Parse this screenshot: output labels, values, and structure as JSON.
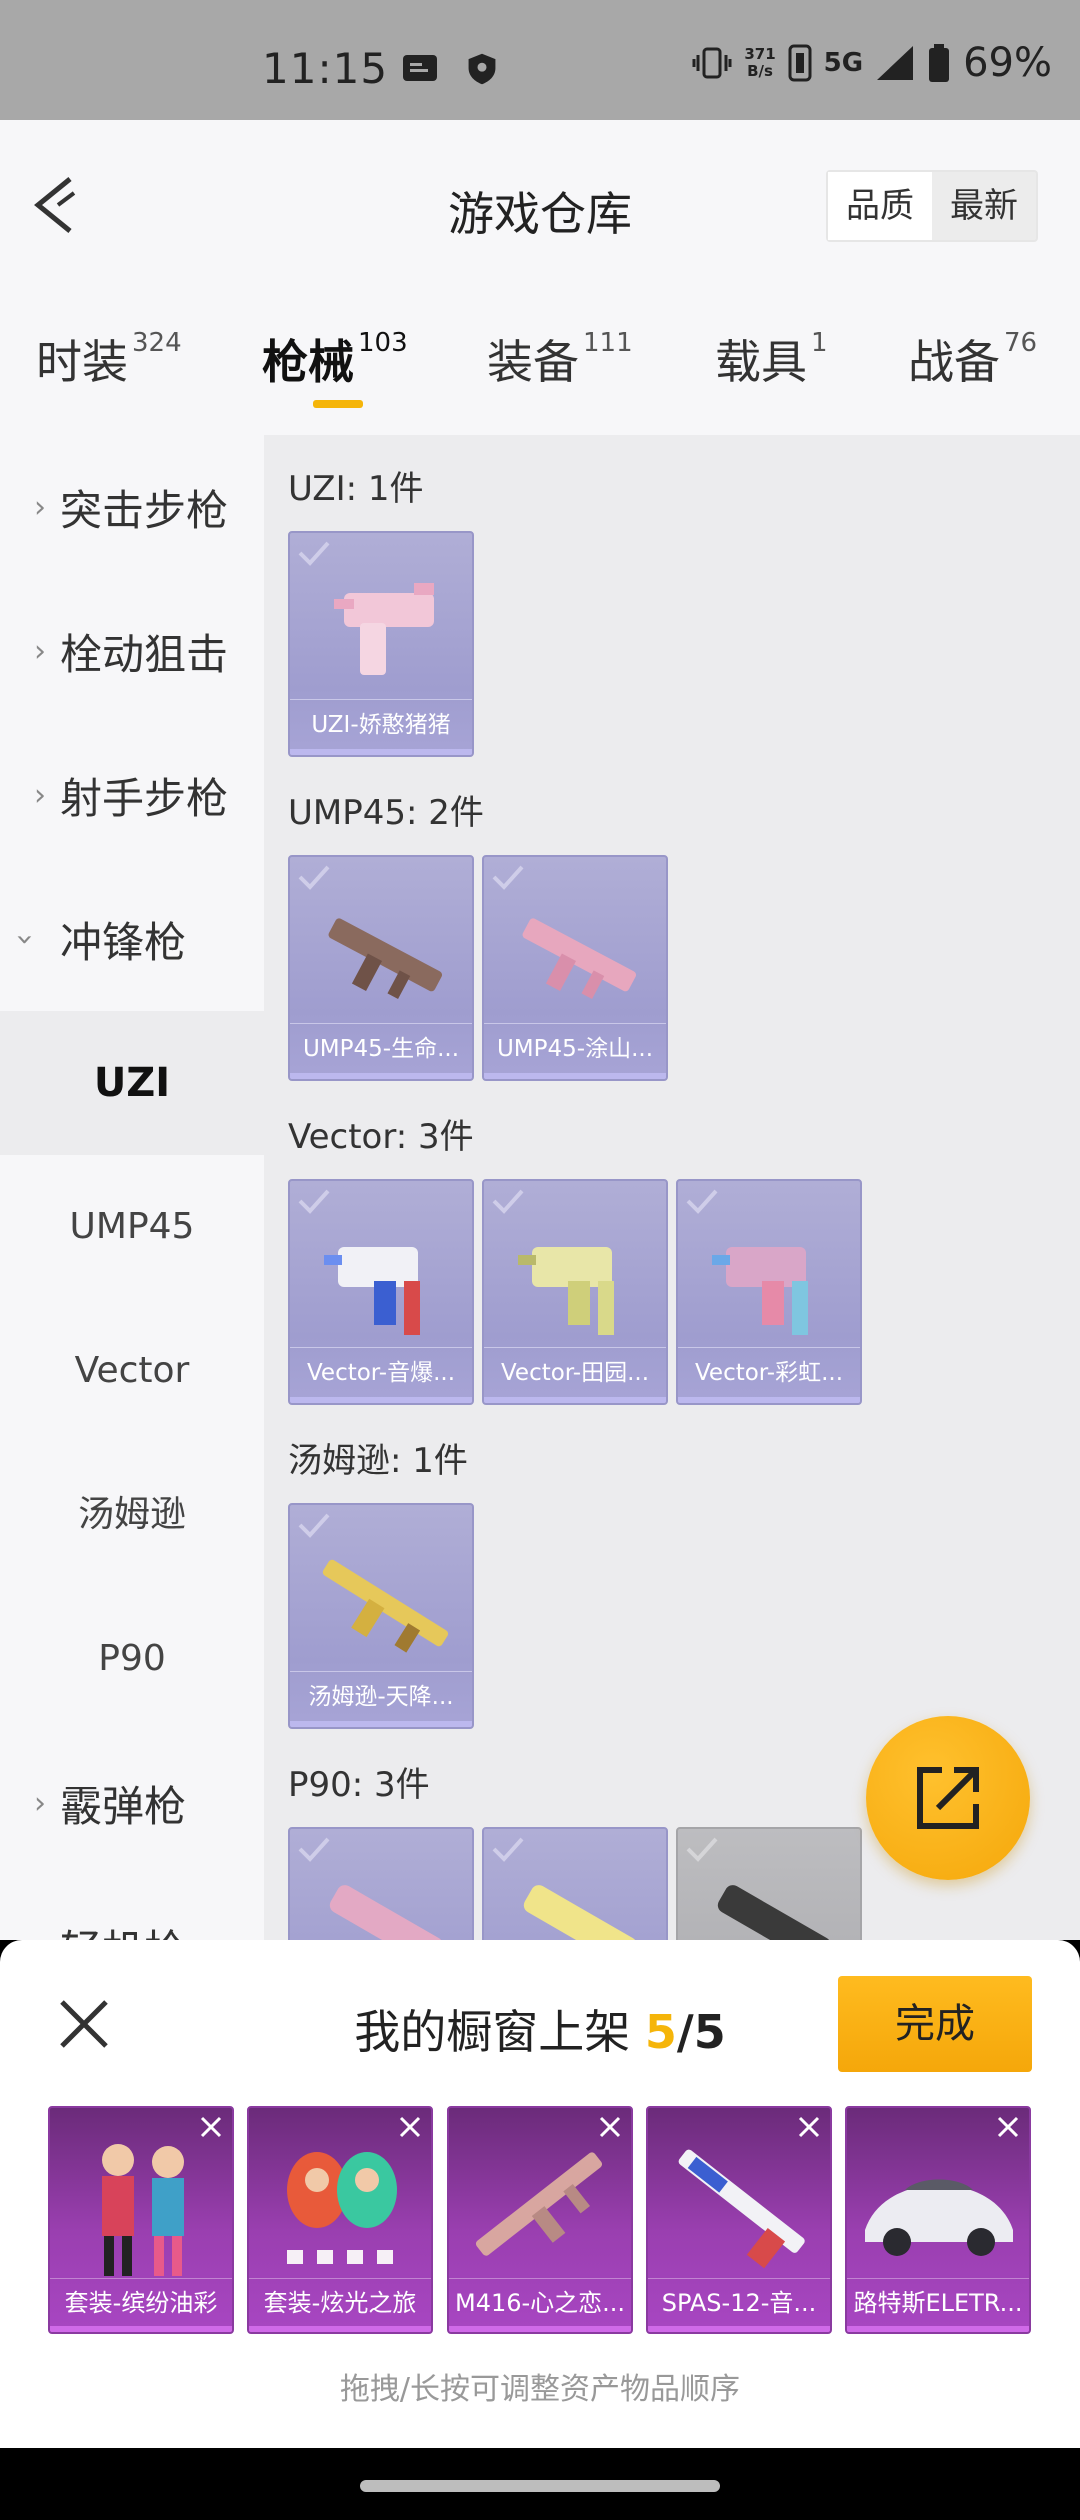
{
  "status": {
    "time": "11:15",
    "net_speed_top": "371",
    "net_speed_bottom": "B/s",
    "network": "5G",
    "battery": "69%"
  },
  "header": {
    "title": "游戏仓库",
    "sort_quality": "品质",
    "sort_newest": "最新"
  },
  "tabs": [
    {
      "label": "时装",
      "count": "324"
    },
    {
      "label": "枪械",
      "count": "103"
    },
    {
      "label": "装备",
      "count": "111"
    },
    {
      "label": "载具",
      "count": "1"
    },
    {
      "label": "战备",
      "count": "76"
    }
  ],
  "sidebar": {
    "categories": [
      "突击步枪",
      "栓动狙击",
      "射手步枪",
      "冲锋枪",
      "霰弹枪",
      "轻机枪"
    ],
    "subcategories": [
      "UZI",
      "UMP45",
      "Vector",
      "汤姆逊",
      "P90"
    ]
  },
  "groups": [
    {
      "title": "UZI: 1件",
      "items": [
        "UZI-娇憨猪猪"
      ]
    },
    {
      "title": "UMP45: 2件",
      "items": [
        "UMP45-生命...",
        "UMP45-涂山..."
      ]
    },
    {
      "title": "Vector: 3件",
      "items": [
        "Vector-音爆...",
        "Vector-田园...",
        "Vector-彩虹..."
      ]
    },
    {
      "title": "汤姆逊: 1件",
      "items": [
        "汤姆逊-天降..."
      ]
    },
    {
      "title": "P90: 3件",
      "items": [
        "",
        "",
        ""
      ]
    }
  ],
  "sheet": {
    "title": "我的橱窗上架",
    "count": "5",
    "slash": "/",
    "total": "5",
    "done_label": "完成",
    "items": [
      "套装-缤纷油彩",
      "套装-炫光之旅",
      "M416-心之恋...",
      "SPAS-12-音...",
      "路特斯ELETR..."
    ],
    "hint": "拖拽/长按可调整资产物品顺序"
  },
  "colors": {
    "accent": "#f5b50a",
    "card_purple": "#a9a6d6",
    "shelf_purple": "#9a3fb0"
  }
}
